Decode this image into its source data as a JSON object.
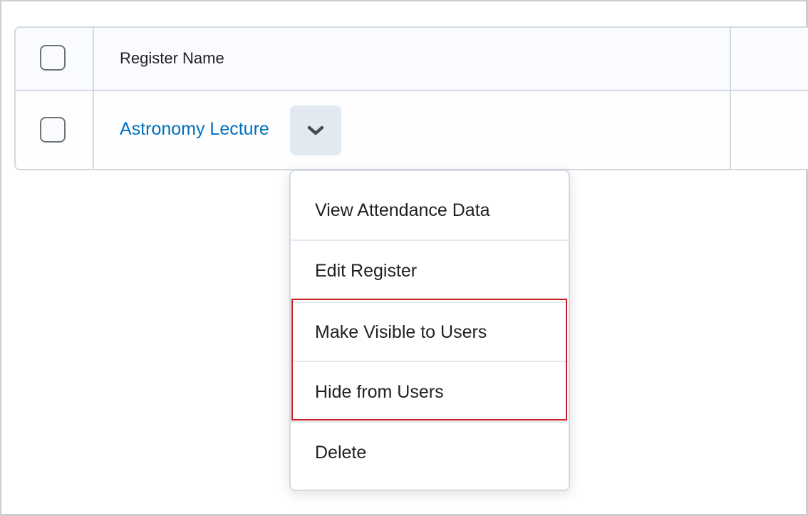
{
  "table": {
    "columns": [
      {
        "type": "select-all-checkbox",
        "checked": false
      },
      {
        "label": "Register Name"
      },
      {
        "label": ""
      }
    ],
    "rows": [
      {
        "checked": false,
        "name": "Astronomy Lecture",
        "actions_icon": "chevron-down-icon"
      }
    ]
  },
  "context_menu": {
    "items": [
      {
        "label": "View Attendance Data"
      },
      {
        "label": "Edit Register"
      },
      {
        "label": "Make Visible to Users",
        "highlighted": true
      },
      {
        "label": "Hide from Users",
        "highlighted": true
      },
      {
        "label": "Delete"
      }
    ]
  },
  "colors": {
    "link": "#006fbf",
    "highlight_border": "#cd2026",
    "table_border": "#d3d9e3",
    "header_bg": "#f9fbff",
    "dropdown_button_bg": "#e3e9f1",
    "text": "#202122"
  }
}
